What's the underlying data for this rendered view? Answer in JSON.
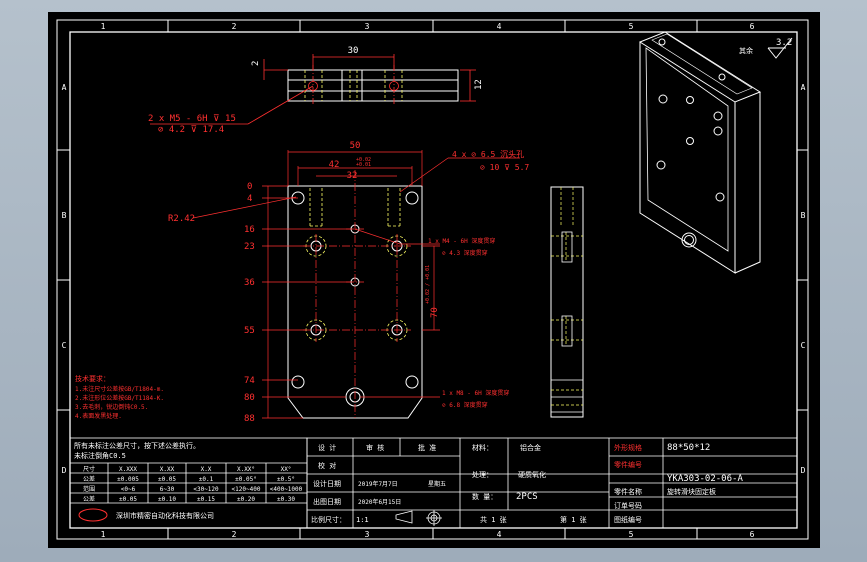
{
  "border": {
    "cols_top": [
      "1",
      "2",
      "3",
      "4",
      "5",
      "6"
    ],
    "cols_bottom": [
      "1",
      "2",
      "3",
      "4",
      "5",
      "6"
    ],
    "rows_left": [
      "A",
      "B",
      "C",
      "D"
    ],
    "rows_right": [
      "A",
      "B",
      "C",
      "D"
    ]
  },
  "top_view": {
    "dim_width": "30",
    "dim_left": "2",
    "dim_height": "12",
    "callout_line1": "2 x  M5 - 6H  ⊽ 15",
    "callout_line2": "⊘  4.2  ⊽ 17.4"
  },
  "front_view": {
    "dim_overall_width": "50",
    "dim_inner_width": "42",
    "dim_tol_upper": "+0.02",
    "dim_tol_lower": "+0.01",
    "dim_center_width": "32",
    "radius": "R2.42",
    "vertical_dims": [
      "0",
      "4",
      "16",
      "23",
      "36",
      "55",
      "74",
      "80",
      "88"
    ],
    "dim_70": "70",
    "dim_70_tol": "+0.02 / +0.01",
    "callout_cbore_1": "4 x  ⊘  6.5 沉头孔",
    "callout_cbore_2": "⊘  10  ⊽ 5.7",
    "callout_hole_1a": "1 x  M4 - 6H 深度贯穿",
    "callout_hole_1b": "⊘  4.3 深度贯穿",
    "callout_hole_2a": "1 x  M8 - 6H 深度贯穿",
    "callout_hole_2b": "⊘  6.8 深度贯穿"
  },
  "roughness": {
    "label": "其余",
    "value": "3.2"
  },
  "tech_notes": {
    "title": "技术要求：",
    "lines": [
      "1.未注尺寸公差按GB/T1804-m.",
      "2.未注形位公差按GB/T1184-K.",
      "3.去毛刺，锐边倒钝C0.5.",
      "4.表面发黑处理."
    ]
  },
  "tolerance_table": {
    "note_line1": "所有未标注公差尺寸，按下述公差执行。",
    "note_line2": "未标注倒角C0.5",
    "header": [
      "尺寸",
      "X.XXX",
      "X.XX",
      "X.X",
      "X.XX°",
      "XX°"
    ],
    "rows": [
      [
        "公差",
        "±0.005",
        "±0.05",
        "±0.1",
        "±0.05°",
        "±0.5°"
      ],
      [
        "范围",
        "<0~6",
        "6~30",
        "<30~120",
        "<120~400",
        "<400~1000"
      ],
      [
        "公差",
        "±0.05",
        "±0.10",
        "±0.15",
        "±0.20",
        "±0.30"
      ]
    ],
    "company": "深圳市精密自动化科技有限公司"
  },
  "title_block": {
    "design_label": "设 计",
    "design_value": "审 核",
    "approve_label": "批 准",
    "proofread_label": "校 对",
    "material_label": "材料：",
    "material_value": "铝合金",
    "draft_label": "设计日期",
    "draft_value": "2019年7月7日",
    "draft_extra": "星期五",
    "surface_label": "处理：",
    "surface_value": "硬质氧化",
    "drawing_label": "出图日期",
    "drawing_value": "2020年6月15日",
    "qty_label": "数 量：",
    "qty_value": "2PCS",
    "scale_label": "比例尺寸：",
    "scale_value": "1:1",
    "sheet_label": "共 1 张",
    "sheet_page": "第 1 张",
    "spec_label": "外形规格",
    "spec_value": "88*50*12",
    "code_label": "零件编号",
    "code_value": "YKA303-02-06-A",
    "name_label": "零件名称",
    "name_value": "旋转滑块固定板",
    "order_label": "订单号码",
    "drawing_no_label": "图纸编号"
  }
}
